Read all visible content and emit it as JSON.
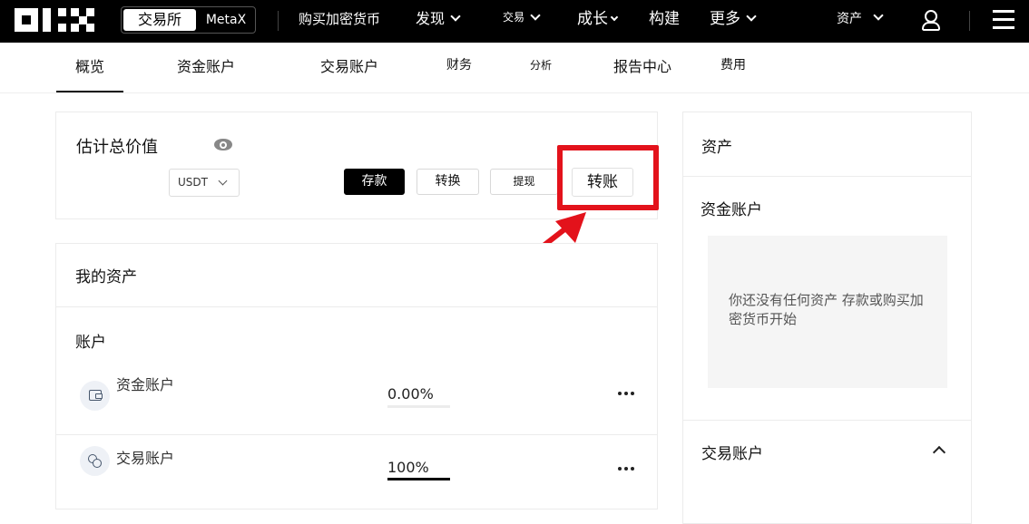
{
  "brand": {
    "logo": "OKX"
  },
  "header": {
    "segment": {
      "active": "交易所",
      "other": "MetaX"
    },
    "nav": [
      {
        "label": "购买加密货币",
        "has_chevron": false
      },
      {
        "label": "发现",
        "has_chevron": true
      },
      {
        "label": "交易",
        "has_chevron": true
      },
      {
        "label": "成长",
        "has_chevron": true
      },
      {
        "label": "构建",
        "has_chevron": false
      },
      {
        "label": "更多",
        "has_chevron": true
      }
    ],
    "assets_menu": "资产",
    "icons": [
      "user-icon",
      "hamburger-menu-icon"
    ]
  },
  "subnav": {
    "tabs": [
      {
        "label": "概览",
        "active": true
      },
      {
        "label": "资金账户"
      },
      {
        "label": "交易账户"
      },
      {
        "label": "财务"
      },
      {
        "label": "分析"
      },
      {
        "label": "报告中心"
      },
      {
        "label": "费用"
      }
    ]
  },
  "estimate": {
    "title": "估计总价值",
    "currency": "USDT",
    "buttons": {
      "deposit": "存款",
      "convert": "转换",
      "withdraw": "提现",
      "transfer": "转账"
    }
  },
  "my_assets": {
    "title": "我的资产",
    "accounts_heading": "账户",
    "accounts": [
      {
        "name": "资金账户",
        "percent": "0.00%",
        "fraction": 0.0,
        "icon": "wallet-icon"
      },
      {
        "name": "交易账户",
        "percent": "100%",
        "fraction": 1.0,
        "icon": "coins-icon"
      }
    ]
  },
  "sidebar": {
    "title": "资产",
    "funding": {
      "title": "资金账户",
      "empty_text": "你还没有任何资产 存款或购买加密货币开始"
    },
    "trading": {
      "title": "交易账户"
    }
  },
  "colors": {
    "highlight": "#e3121b",
    "header_bg": "#000000",
    "primary_button": "#000000"
  }
}
